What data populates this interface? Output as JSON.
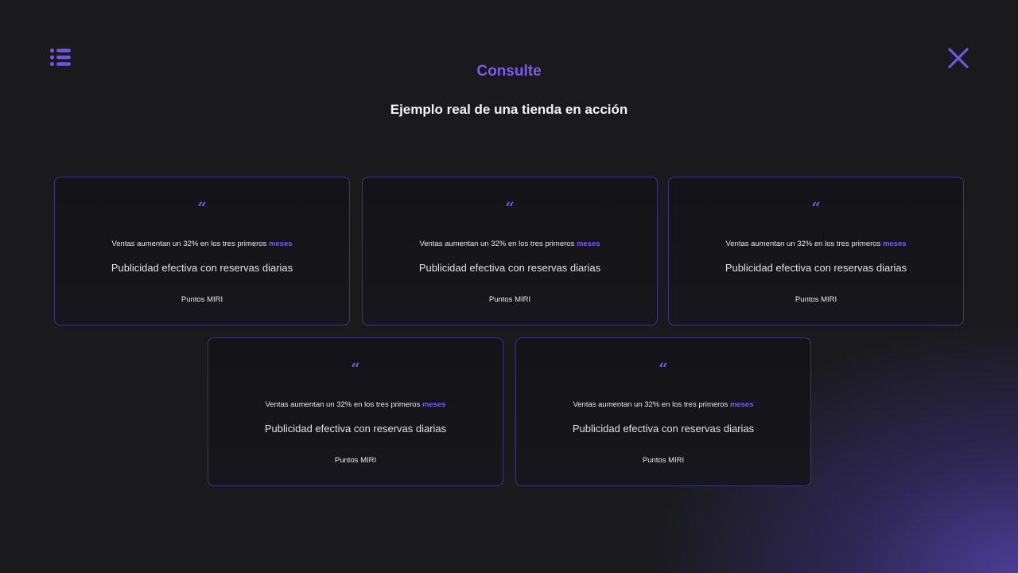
{
  "header": {
    "menu_icon": "list-icon",
    "close_icon": "close-icon",
    "eyebrow": "Consulte",
    "heading": "Ejemplo real de una tienda en acción"
  },
  "colors": {
    "accent": "#7b5cf0",
    "background": "#1a1a1d",
    "card_border": "#3e3580"
  },
  "testimonials": [
    {
      "quote_mark": "“",
      "stat_text": "Ventas aumentan un 32% en los tres primeros",
      "stat_highlight": "meses",
      "title": "Publicidad efectiva con reservas diarias",
      "author": "Puntos MIRI"
    },
    {
      "quote_mark": "“",
      "stat_text": "Ventas aumentan un 32% en los tres primeros",
      "stat_highlight": "meses",
      "title": "Publicidad efectiva con reservas diarias",
      "author": "Puntos MIRI"
    },
    {
      "quote_mark": "“",
      "stat_text": "Ventas aumentan un 32% en los tres primeros",
      "stat_highlight": "meses",
      "title": "Publicidad efectiva con reservas diarias",
      "author": "Puntos MIRI"
    },
    {
      "quote_mark": "“",
      "stat_text": "Ventas aumentan un 32% en los tres primeros",
      "stat_highlight": "meses",
      "title": "Publicidad efectiva con reservas diarias",
      "author": "Puntos MIRI"
    },
    {
      "quote_mark": "“",
      "stat_text": "Ventas aumentan un 32% en los tres primeros",
      "stat_highlight": "meses",
      "title": "Publicidad efectiva con reservas diarias",
      "author": "Puntos MIRI"
    }
  ]
}
